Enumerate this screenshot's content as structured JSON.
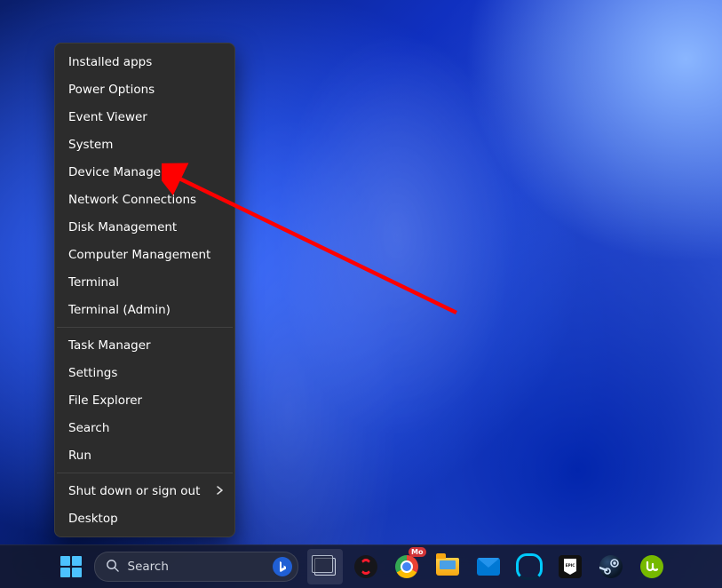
{
  "menu": {
    "groups": [
      {
        "items": [
          {
            "id": "installed-apps",
            "label": "Installed apps"
          },
          {
            "id": "power-options",
            "label": "Power Options"
          },
          {
            "id": "event-viewer",
            "label": "Event Viewer"
          },
          {
            "id": "system",
            "label": "System"
          },
          {
            "id": "device-manager",
            "label": "Device Manager"
          },
          {
            "id": "network-connections",
            "label": "Network Connections"
          },
          {
            "id": "disk-management",
            "label": "Disk Management"
          },
          {
            "id": "computer-management",
            "label": "Computer Management"
          },
          {
            "id": "terminal",
            "label": "Terminal"
          },
          {
            "id": "terminal-admin",
            "label": "Terminal (Admin)"
          }
        ]
      },
      {
        "items": [
          {
            "id": "task-manager",
            "label": "Task Manager"
          },
          {
            "id": "settings",
            "label": "Settings"
          },
          {
            "id": "file-explorer",
            "label": "File Explorer"
          },
          {
            "id": "search",
            "label": "Search"
          },
          {
            "id": "run",
            "label": "Run"
          }
        ]
      },
      {
        "items": [
          {
            "id": "shut-down",
            "label": "Shut down or sign out",
            "submenu": true
          },
          {
            "id": "desktop",
            "label": "Desktop"
          }
        ]
      }
    ]
  },
  "annotation": {
    "target_item": "device-manager",
    "color": "#ff0000"
  },
  "taskbar": {
    "search_placeholder": "Search",
    "chrome_badge": "Mo",
    "epic_label": "EPIC"
  }
}
